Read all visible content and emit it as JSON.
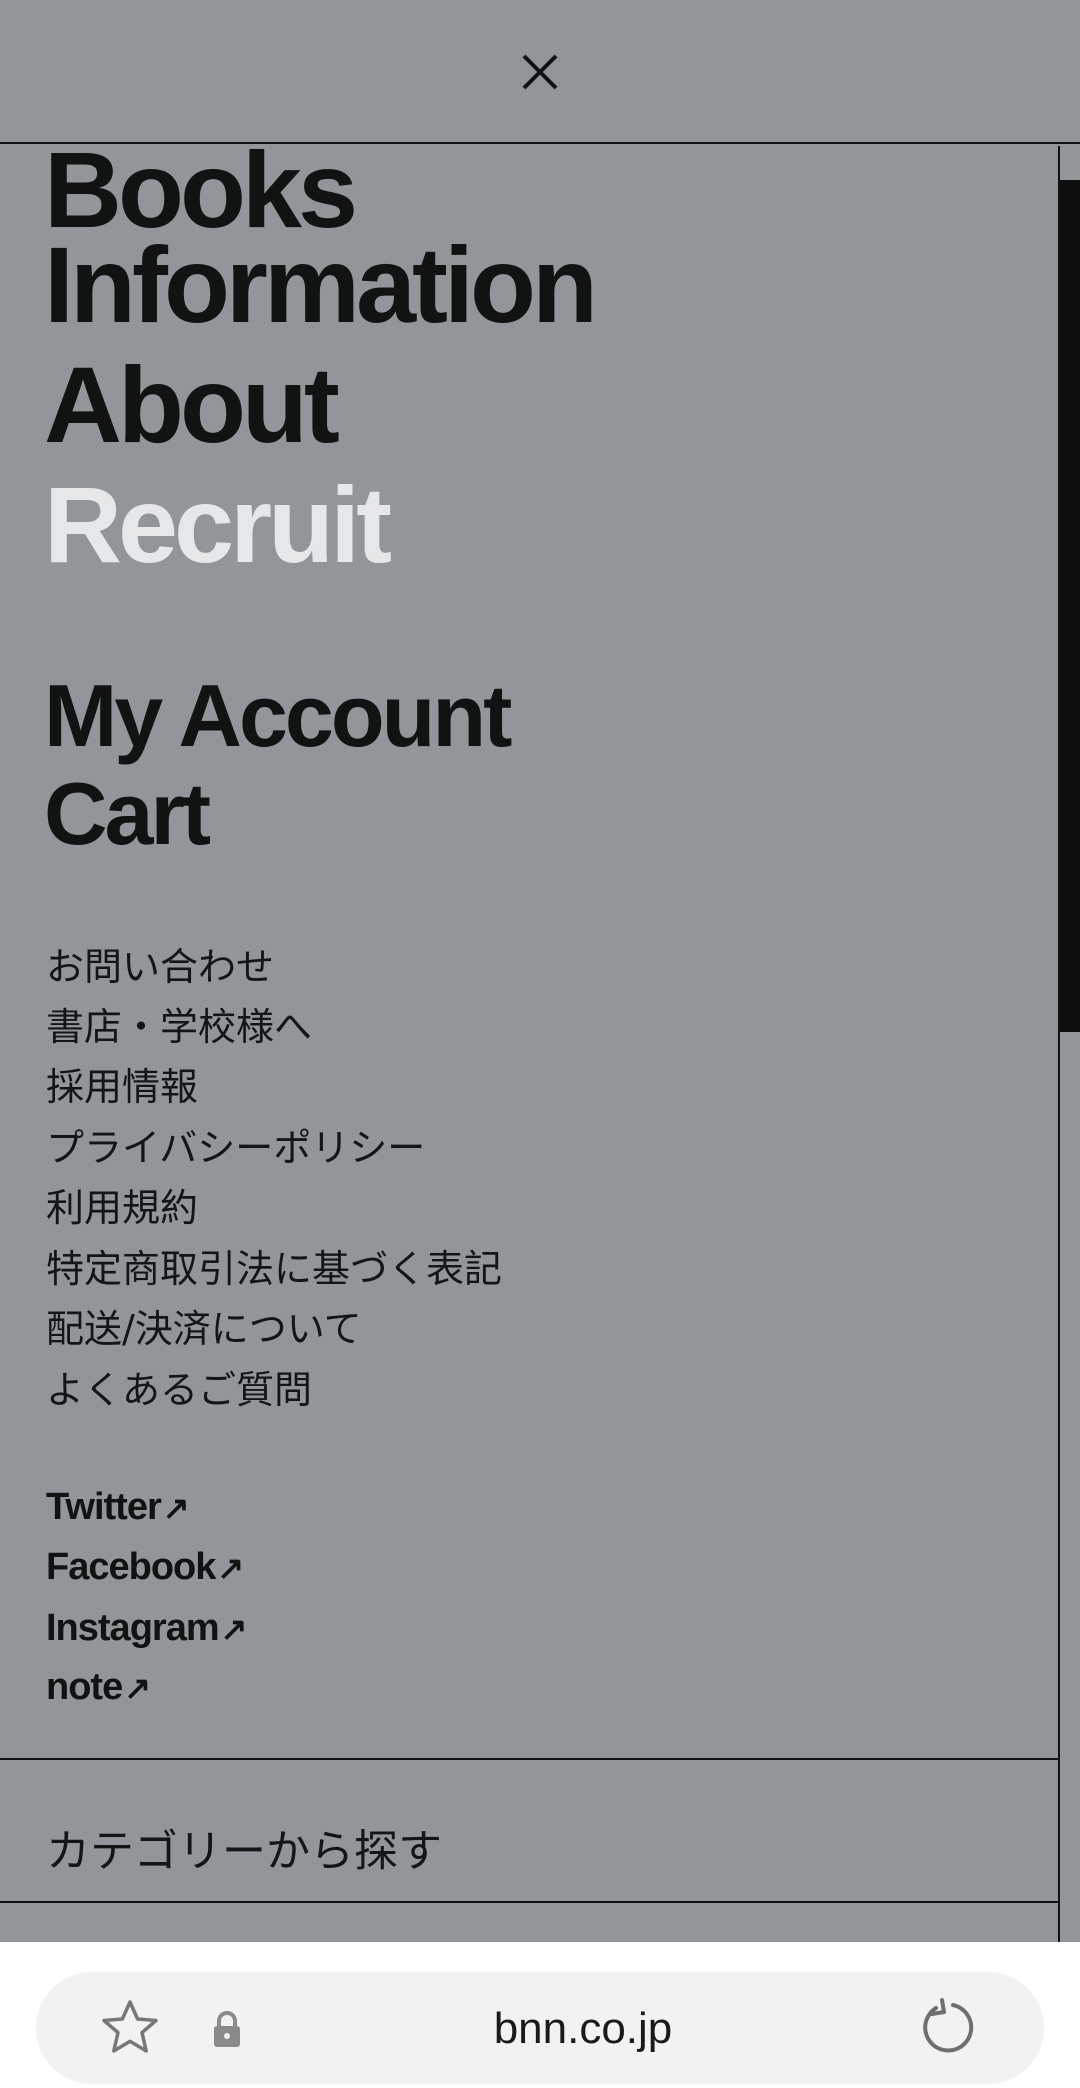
{
  "header": {
    "close_icon": "close-icon"
  },
  "main_nav": [
    {
      "label": "Books",
      "active": false
    },
    {
      "label": "Information",
      "active": false
    },
    {
      "label": "About",
      "active": false
    },
    {
      "label": "Recruit",
      "active": true
    }
  ],
  "account_nav": [
    {
      "label": "My Account"
    },
    {
      "label": "Cart"
    }
  ],
  "info_links": [
    {
      "label": "お問い合わせ"
    },
    {
      "label": "書店・学校様へ"
    },
    {
      "label": "採用情報"
    },
    {
      "label": "プライバシーポリシー"
    },
    {
      "label": "利用規約"
    },
    {
      "label": "特定商取引法に基づく表記"
    },
    {
      "label": "配送/決済について"
    },
    {
      "label": "よくあるご質問"
    }
  ],
  "social_links": [
    {
      "label": "Twitter",
      "arrow": "↗"
    },
    {
      "label": "Facebook",
      "arrow": "↗"
    },
    {
      "label": "Instagram",
      "arrow": "↗"
    },
    {
      "label": "note",
      "arrow": "↗"
    }
  ],
  "category_section": {
    "label": "カテゴリーから探す"
  },
  "browser": {
    "url": "bnn.co.jp",
    "bookmark_icon": "star-icon",
    "secure_icon": "lock-icon",
    "reload_icon": "reload-icon"
  },
  "colors": {
    "background": "#92969a",
    "text": "#111313",
    "active_text": "#e6e7e8",
    "browser_bar": "#ffffff",
    "url_pill": "#f2f2f2"
  }
}
